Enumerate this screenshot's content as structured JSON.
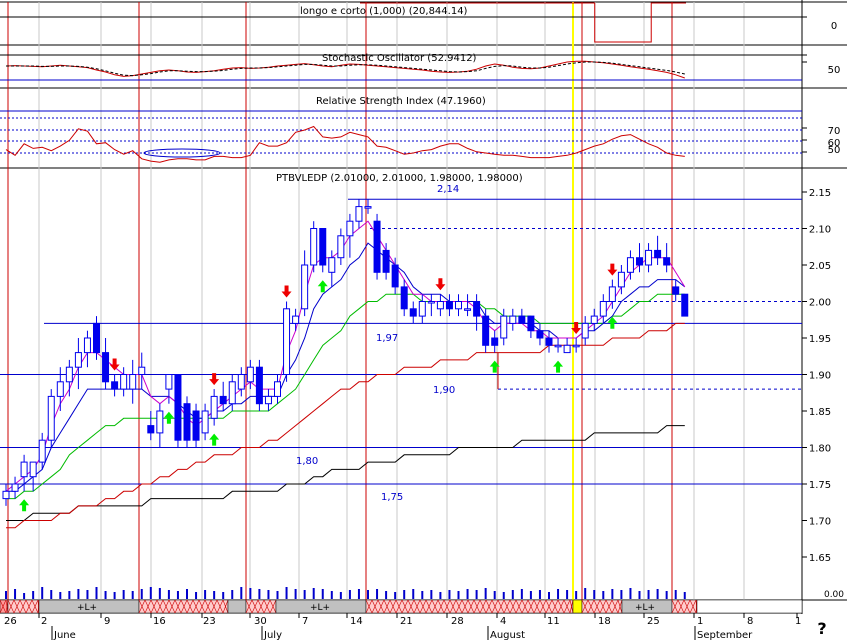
{
  "panels": {
    "top": {
      "title": "longo e corto (1,000) (20,844.14)",
      "ticks": [
        "0"
      ]
    },
    "stochastic": {
      "title": "Stochastic Oscillator (52.9412)",
      "ticks": [
        "50"
      ]
    },
    "rsi": {
      "title": "Relative Strength Index (47.1960)",
      "ticks": [
        "70",
        "60",
        "50"
      ]
    },
    "price": {
      "title": "PTBVLEDP (2.01000, 2.01000, 1.98000, 1.98000)",
      "ticks": [
        "2.15",
        "2.10",
        "2.05",
        "2.00",
        "1.95",
        "1.90",
        "1.85",
        "1.80",
        "1.75",
        "1.70",
        "1.65"
      ],
      "level_labels": [
        "2,14",
        "1,97",
        "1,90",
        "1,80",
        "1,75"
      ],
      "volume_tick": "0.00"
    }
  },
  "time_axis": {
    "day_labels": [
      "26",
      "2",
      "9",
      "16",
      "23",
      "30",
      "7",
      "14",
      "21",
      "28",
      "4",
      "11",
      "18",
      "25",
      "1",
      "8",
      "1"
    ],
    "month_labels": [
      "June",
      "July",
      "August",
      "September"
    ],
    "strip_labels": [
      "+L+",
      "+L+",
      "+L+"
    ]
  },
  "corner_glyph": "?",
  "colors": {
    "up_signal": "#00ee00",
    "down_signal": "#ee0000",
    "candle": "#0000ee",
    "ema_fast": "#cc00cc",
    "ema_mid": "#0000cc",
    "ema_slow": "#00bb00",
    "ma_long": "#cc0000",
    "ma_longest": "#000000",
    "highlight_day": "#ffff00"
  },
  "chart_data": {
    "type": "candlestick",
    "symbol": "PTBVLEDP",
    "ohlc_last": {
      "open": 2.01,
      "high": 2.01,
      "low": 1.98,
      "close": 1.98
    },
    "y_range": [
      1.6,
      2.17
    ],
    "horizontal_levels": [
      2.14,
      2.1,
      2.0,
      1.97,
      1.9,
      1.88,
      1.8,
      1.75
    ],
    "dashed_levels": [
      2.1,
      2.0,
      1.88
    ],
    "candles": [
      {
        "o": 1.73,
        "h": 1.75,
        "l": 1.72,
        "c": 1.74
      },
      {
        "o": 1.74,
        "h": 1.76,
        "l": 1.73,
        "c": 1.75
      },
      {
        "o": 1.76,
        "h": 1.79,
        "l": 1.74,
        "c": 1.78
      },
      {
        "o": 1.76,
        "h": 1.78,
        "l": 1.74,
        "c": 1.78
      },
      {
        "o": 1.78,
        "h": 1.82,
        "l": 1.77,
        "c": 1.81
      },
      {
        "o": 1.81,
        "h": 1.88,
        "l": 1.8,
        "c": 1.87
      },
      {
        "o": 1.87,
        "h": 1.91,
        "l": 1.85,
        "c": 1.89
      },
      {
        "o": 1.89,
        "h": 1.92,
        "l": 1.87,
        "c": 1.91
      },
      {
        "o": 1.91,
        "h": 1.95,
        "l": 1.88,
        "c": 1.93
      },
      {
        "o": 1.93,
        "h": 1.96,
        "l": 1.91,
        "c": 1.95
      },
      {
        "o": 1.97,
        "h": 1.98,
        "l": 1.92,
        "c": 1.93
      },
      {
        "o": 1.93,
        "h": 1.95,
        "l": 1.88,
        "c": 1.89
      },
      {
        "o": 1.89,
        "h": 1.9,
        "l": 1.87,
        "c": 1.88
      },
      {
        "o": 1.88,
        "h": 1.91,
        "l": 1.87,
        "c": 1.9
      },
      {
        "o": 1.88,
        "h": 1.92,
        "l": 1.86,
        "c": 1.9
      },
      {
        "o": 1.9,
        "h": 1.93,
        "l": 1.88,
        "c": 1.91
      },
      {
        "o": 1.83,
        "h": 1.85,
        "l": 1.81,
        "c": 1.82
      },
      {
        "o": 1.82,
        "h": 1.86,
        "l": 1.8,
        "c": 1.85
      },
      {
        "o": 1.88,
        "h": 1.9,
        "l": 1.86,
        "c": 1.9
      },
      {
        "o": 1.9,
        "h": 1.9,
        "l": 1.8,
        "c": 1.81
      },
      {
        "o": 1.86,
        "h": 1.87,
        "l": 1.8,
        "c": 1.81
      },
      {
        "o": 1.85,
        "h": 1.86,
        "l": 1.8,
        "c": 1.81
      },
      {
        "o": 1.82,
        "h": 1.86,
        "l": 1.81,
        "c": 1.85
      },
      {
        "o": 1.84,
        "h": 1.88,
        "l": 1.83,
        "c": 1.87
      },
      {
        "o": 1.87,
        "h": 1.89,
        "l": 1.85,
        "c": 1.86
      },
      {
        "o": 1.86,
        "h": 1.9,
        "l": 1.85,
        "c": 1.89
      },
      {
        "o": 1.88,
        "h": 1.91,
        "l": 1.87,
        "c": 1.9
      },
      {
        "o": 1.89,
        "h": 1.92,
        "l": 1.88,
        "c": 1.91
      },
      {
        "o": 1.91,
        "h": 1.92,
        "l": 1.85,
        "c": 1.86
      },
      {
        "o": 1.86,
        "h": 1.88,
        "l": 1.85,
        "c": 1.87
      },
      {
        "o": 1.87,
        "h": 1.9,
        "l": 1.86,
        "c": 1.89
      },
      {
        "o": 1.9,
        "h": 2.0,
        "l": 1.89,
        "c": 1.99
      },
      {
        "o": 1.97,
        "h": 1.99,
        "l": 1.96,
        "c": 1.98
      },
      {
        "o": 1.99,
        "h": 2.07,
        "l": 1.98,
        "c": 2.05
      },
      {
        "o": 2.05,
        "h": 2.11,
        "l": 2.04,
        "c": 2.1
      },
      {
        "o": 2.1,
        "h": 2.1,
        "l": 2.04,
        "c": 2.05
      },
      {
        "o": 2.04,
        "h": 2.07,
        "l": 2.02,
        "c": 2.06
      },
      {
        "o": 2.06,
        "h": 2.1,
        "l": 2.05,
        "c": 2.09
      },
      {
        "o": 2.09,
        "h": 2.12,
        "l": 2.06,
        "c": 2.11
      },
      {
        "o": 2.11,
        "h": 2.14,
        "l": 2.1,
        "c": 2.13
      },
      {
        "o": 2.13,
        "h": 2.14,
        "l": 2.12,
        "c": 2.13
      },
      {
        "o": 2.11,
        "h": 2.12,
        "l": 2.03,
        "c": 2.04
      },
      {
        "o": 2.07,
        "h": 2.08,
        "l": 2.03,
        "c": 2.04
      },
      {
        "o": 2.05,
        "h": 2.06,
        "l": 2.01,
        "c": 2.02
      },
      {
        "o": 2.02,
        "h": 2.03,
        "l": 1.98,
        "c": 1.99
      },
      {
        "o": 1.99,
        "h": 2.0,
        "l": 1.97,
        "c": 1.98
      },
      {
        "o": 1.98,
        "h": 2.01,
        "l": 1.97,
        "c": 2.0
      },
      {
        "o": 2.0,
        "h": 2.01,
        "l": 1.98,
        "c": 2.0
      },
      {
        "o": 1.99,
        "h": 2.01,
        "l": 1.98,
        "c": 2.0
      },
      {
        "o": 2.0,
        "h": 2.01,
        "l": 1.98,
        "c": 1.99
      },
      {
        "o": 1.99,
        "h": 2.01,
        "l": 1.98,
        "c": 2.0
      },
      {
        "o": 1.99,
        "h": 2.01,
        "l": 1.98,
        "c": 1.99
      },
      {
        "o": 2.0,
        "h": 2.01,
        "l": 1.96,
        "c": 1.98
      },
      {
        "o": 1.98,
        "h": 1.99,
        "l": 1.93,
        "c": 1.94
      },
      {
        "o": 1.95,
        "h": 1.96,
        "l": 1.93,
        "c": 1.94
      },
      {
        "o": 1.95,
        "h": 1.99,
        "l": 1.94,
        "c": 1.98
      },
      {
        "o": 1.97,
        "h": 1.99,
        "l": 1.96,
        "c": 1.98
      },
      {
        "o": 1.98,
        "h": 1.99,
        "l": 1.97,
        "c": 1.97
      },
      {
        "o": 1.98,
        "h": 1.98,
        "l": 1.95,
        "c": 1.96
      },
      {
        "o": 1.96,
        "h": 1.97,
        "l": 1.94,
        "c": 1.95
      },
      {
        "o": 1.95,
        "h": 1.96,
        "l": 1.93,
        "c": 1.94
      },
      {
        "o": 1.94,
        "h": 1.95,
        "l": 1.93,
        "c": 1.94
      },
      {
        "o": 1.93,
        "h": 1.95,
        "l": 1.93,
        "c": 1.94
      },
      {
        "o": 1.94,
        "h": 1.95,
        "l": 1.93,
        "c": 1.94
      },
      {
        "o": 1.95,
        "h": 1.98,
        "l": 1.94,
        "c": 1.97
      },
      {
        "o": 1.97,
        "h": 1.99,
        "l": 1.96,
        "c": 1.98
      },
      {
        "o": 1.98,
        "h": 2.01,
        "l": 1.97,
        "c": 2.0
      },
      {
        "o": 2.0,
        "h": 2.03,
        "l": 1.99,
        "c": 2.02
      },
      {
        "o": 2.02,
        "h": 2.05,
        "l": 2.01,
        "c": 2.04
      },
      {
        "o": 2.04,
        "h": 2.07,
        "l": 2.03,
        "c": 2.06
      },
      {
        "o": 2.06,
        "h": 2.08,
        "l": 2.04,
        "c": 2.05
      },
      {
        "o": 2.05,
        "h": 2.08,
        "l": 2.04,
        "c": 2.07
      },
      {
        "o": 2.07,
        "h": 2.09,
        "l": 2.05,
        "c": 2.06
      },
      {
        "o": 2.06,
        "h": 2.08,
        "l": 2.04,
        "c": 2.05
      },
      {
        "o": 2.02,
        "h": 2.03,
        "l": 2.0,
        "c": 2.01
      },
      {
        "o": 2.01,
        "h": 2.01,
        "l": 1.98,
        "c": 1.98
      }
    ],
    "ema_fast": [
      1.74,
      1.75,
      1.76,
      1.77,
      1.79,
      1.83,
      1.86,
      1.88,
      1.91,
      1.93,
      1.93,
      1.92,
      1.91,
      1.9,
      1.9,
      1.9,
      1.87,
      1.86,
      1.87,
      1.86,
      1.84,
      1.83,
      1.84,
      1.85,
      1.86,
      1.87,
      1.88,
      1.89,
      1.88,
      1.88,
      1.88,
      1.93,
      1.96,
      2.01,
      2.05,
      2.06,
      2.06,
      2.07,
      2.09,
      2.1,
      2.11,
      2.09,
      2.07,
      2.05,
      2.03,
      2.01,
      2.01,
      2.0,
      2.0,
      2.0,
      2.0,
      2.0,
      1.99,
      1.97,
      1.96,
      1.97,
      1.97,
      1.97,
      1.96,
      1.96,
      1.95,
      1.95,
      1.95,
      1.95,
      1.96,
      1.97,
      1.98,
      2.0,
      2.02,
      2.04,
      2.05,
      2.06,
      2.06,
      2.06,
      2.04,
      2.02
    ],
    "ema_mid": [
      1.74,
      1.74,
      1.75,
      1.76,
      1.77,
      1.8,
      1.82,
      1.84,
      1.86,
      1.88,
      1.88,
      1.88,
      1.88,
      1.88,
      1.88,
      1.88,
      1.87,
      1.87,
      1.87,
      1.86,
      1.85,
      1.84,
      1.84,
      1.85,
      1.85,
      1.86,
      1.86,
      1.87,
      1.87,
      1.87,
      1.87,
      1.9,
      1.92,
      1.95,
      1.99,
      2.01,
      2.02,
      2.03,
      2.05,
      2.06,
      2.08,
      2.07,
      2.06,
      2.05,
      2.04,
      2.02,
      2.01,
      2.01,
      2.01,
      2.0,
      2.0,
      2.0,
      2.0,
      1.98,
      1.97,
      1.97,
      1.97,
      1.97,
      1.97,
      1.96,
      1.96,
      1.95,
      1.95,
      1.95,
      1.96,
      1.96,
      1.97,
      1.98,
      2.0,
      2.01,
      2.02,
      2.02,
      2.03,
      2.03,
      2.03,
      2.02
    ],
    "ema_slow": [
      1.73,
      1.73,
      1.74,
      1.74,
      1.75,
      1.76,
      1.77,
      1.79,
      1.8,
      1.81,
      1.82,
      1.83,
      1.83,
      1.84,
      1.84,
      1.84,
      1.84,
      1.84,
      1.84,
      1.84,
      1.84,
      1.84,
      1.84,
      1.84,
      1.84,
      1.85,
      1.85,
      1.85,
      1.85,
      1.85,
      1.86,
      1.87,
      1.88,
      1.9,
      1.92,
      1.94,
      1.95,
      1.96,
      1.98,
      1.99,
      2.0,
      2.0,
      2.01,
      2.01,
      2.01,
      2.01,
      2.0,
      2.0,
      2.0,
      2.0,
      2.0,
      2.0,
      2.0,
      1.99,
      1.99,
      1.98,
      1.98,
      1.98,
      1.98,
      1.97,
      1.97,
      1.97,
      1.97,
      1.97,
      1.97,
      1.97,
      1.97,
      1.98,
      1.98,
      1.99,
      2.0,
      2.0,
      2.01,
      2.01,
      2.01,
      2.01
    ],
    "ma_long": [
      1.69,
      1.69,
      1.7,
      1.7,
      1.7,
      1.7,
      1.71,
      1.71,
      1.72,
      1.72,
      1.72,
      1.73,
      1.73,
      1.74,
      1.74,
      1.75,
      1.75,
      1.76,
      1.76,
      1.77,
      1.77,
      1.78,
      1.78,
      1.79,
      1.79,
      1.79,
      1.8,
      1.8,
      1.8,
      1.81,
      1.81,
      1.82,
      1.83,
      1.84,
      1.85,
      1.86,
      1.87,
      1.88,
      1.88,
      1.89,
      1.89,
      1.9,
      1.9,
      1.9,
      1.91,
      1.91,
      1.91,
      1.91,
      1.92,
      1.92,
      1.92,
      1.92,
      1.93,
      1.93,
      1.93,
      1.93,
      1.93,
      1.93,
      1.93,
      1.93,
      1.94,
      1.94,
      1.94,
      1.94,
      1.94,
      1.94,
      1.94,
      1.95,
      1.95,
      1.95,
      1.95,
      1.96,
      1.96,
      1.96,
      1.97,
      1.97
    ],
    "ma_longest": [
      1.7,
      1.7,
      1.7,
      1.71,
      1.71,
      1.71,
      1.71,
      1.71,
      1.72,
      1.72,
      1.72,
      1.72,
      1.72,
      1.72,
      1.72,
      1.72,
      1.73,
      1.73,
      1.73,
      1.73,
      1.73,
      1.73,
      1.73,
      1.73,
      1.73,
      1.74,
      1.74,
      1.74,
      1.74,
      1.74,
      1.74,
      1.75,
      1.75,
      1.75,
      1.76,
      1.76,
      1.77,
      1.77,
      1.77,
      1.77,
      1.78,
      1.78,
      1.78,
      1.78,
      1.79,
      1.79,
      1.79,
      1.79,
      1.79,
      1.79,
      1.8,
      1.8,
      1.8,
      1.8,
      1.8,
      1.8,
      1.8,
      1.81,
      1.81,
      1.81,
      1.81,
      1.81,
      1.81,
      1.81,
      1.81,
      1.82,
      1.82,
      1.82,
      1.82,
      1.82,
      1.82,
      1.82,
      1.82,
      1.83,
      1.83,
      1.83
    ],
    "buy_signals": [
      2,
      18,
      23,
      35,
      54,
      61,
      67
    ],
    "sell_signals": [
      12,
      23,
      31,
      48,
      63,
      67,
      78
    ],
    "volume": [
      8,
      10,
      6,
      8,
      12,
      9,
      7,
      8,
      10,
      9,
      12,
      8,
      7,
      9,
      8,
      10,
      12,
      11,
      9,
      8,
      10,
      7,
      9,
      8,
      7,
      9,
      12,
      11,
      10,
      9,
      8,
      12,
      10,
      9,
      11,
      10,
      8,
      7,
      9,
      10,
      9,
      10,
      8,
      7,
      9,
      10,
      8,
      9,
      7,
      9,
      8,
      10,
      9,
      11,
      8,
      7,
      9,
      10,
      8,
      9,
      7,
      10,
      9,
      8,
      11,
      9,
      8,
      10,
      9,
      11,
      8,
      9,
      10,
      8,
      9,
      7
    ],
    "stochastic": [
      60,
      61,
      60,
      59,
      58,
      60,
      62,
      60,
      58,
      56,
      50,
      45,
      38,
      34,
      36,
      40,
      44,
      48,
      50,
      48,
      45,
      44,
      46,
      48,
      52,
      55,
      56,
      54,
      55,
      57,
      60,
      62,
      64,
      66,
      63,
      60,
      58,
      62,
      65,
      64,
      62,
      60,
      58,
      56,
      54,
      52,
      50,
      47,
      45,
      44,
      45,
      47,
      52,
      60,
      65,
      62,
      57,
      54,
      53,
      55,
      60,
      65,
      70,
      72,
      72,
      70,
      68,
      65,
      62,
      58,
      55,
      52,
      48,
      44,
      38,
      30
    ],
    "stochastic_signal": [
      60,
      60,
      60,
      60,
      59,
      59,
      60,
      60,
      59,
      57,
      53,
      48,
      42,
      37,
      36,
      38,
      41,
      45,
      48,
      48,
      47,
      46,
      46,
      47,
      49,
      52,
      54,
      55,
      55,
      56,
      58,
      60,
      62,
      64,
      64,
      62,
      60,
      60,
      62,
      63,
      63,
      62,
      60,
      58,
      56,
      54,
      52,
      50,
      48,
      46,
      45,
      46,
      48,
      54,
      59,
      61,
      60,
      57,
      55,
      55,
      57,
      61,
      65,
      68,
      70,
      70,
      69,
      67,
      64,
      61,
      58,
      55,
      52,
      49,
      45,
      40
    ],
    "rsi": [
      53,
      48,
      58,
      54,
      55,
      52,
      56,
      61,
      71,
      69,
      58,
      59,
      53,
      49,
      52,
      45,
      43,
      42,
      44,
      45,
      45,
      44,
      44,
      47,
      47,
      46,
      46,
      48,
      59,
      56,
      56,
      59,
      68,
      70,
      73,
      64,
      63,
      64,
      68,
      66,
      64,
      56,
      55,
      52,
      49,
      50,
      52,
      53,
      56,
      58,
      58,
      54,
      51,
      50,
      49,
      48,
      48,
      47,
      46,
      46,
      46,
      47,
      48,
      50,
      53,
      56,
      58,
      62,
      65,
      66,
      62,
      58,
      55,
      50,
      48,
      47
    ],
    "long_short": [
      1,
      1,
      1,
      1,
      1,
      1,
      1,
      1,
      1,
      1,
      1,
      1,
      1,
      1,
      1,
      1,
      1,
      1,
      1,
      1,
      1,
      1,
      1,
      1,
      1,
      1,
      1,
      1,
      1,
      1,
      1,
      1,
      1,
      1,
      1,
      1,
      1,
      1,
      1,
      1,
      1,
      1,
      1,
      1,
      1,
      1,
      1,
      1,
      1,
      1,
      1,
      1,
      1,
      1,
      0,
      0,
      0,
      0,
      0,
      0,
      0,
      0,
      0,
      0,
      0,
      0,
      0,
      1,
      1,
      1,
      1,
      1,
      1,
      1,
      1,
      1
    ]
  }
}
